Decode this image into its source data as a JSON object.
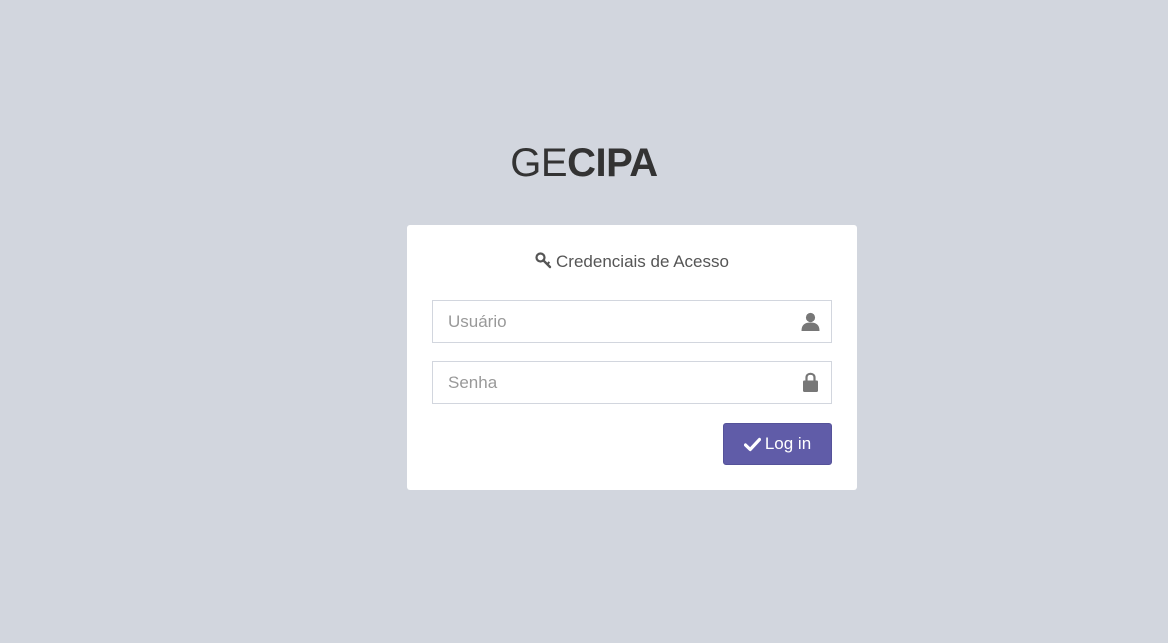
{
  "logo": {
    "light": "GE",
    "bold": "CIPA"
  },
  "login_box": {
    "title": "Credenciais de Acesso",
    "title_icon": "key-icon",
    "username": {
      "placeholder": "Usuário",
      "value": "",
      "icon": "user-icon"
    },
    "password": {
      "placeholder": "Senha",
      "value": "",
      "icon": "lock-icon"
    },
    "submit": {
      "label": "Log in",
      "icon": "check-icon"
    }
  },
  "colors": {
    "background": "#d2d6de",
    "button": "#605ca8",
    "box": "#ffffff"
  }
}
